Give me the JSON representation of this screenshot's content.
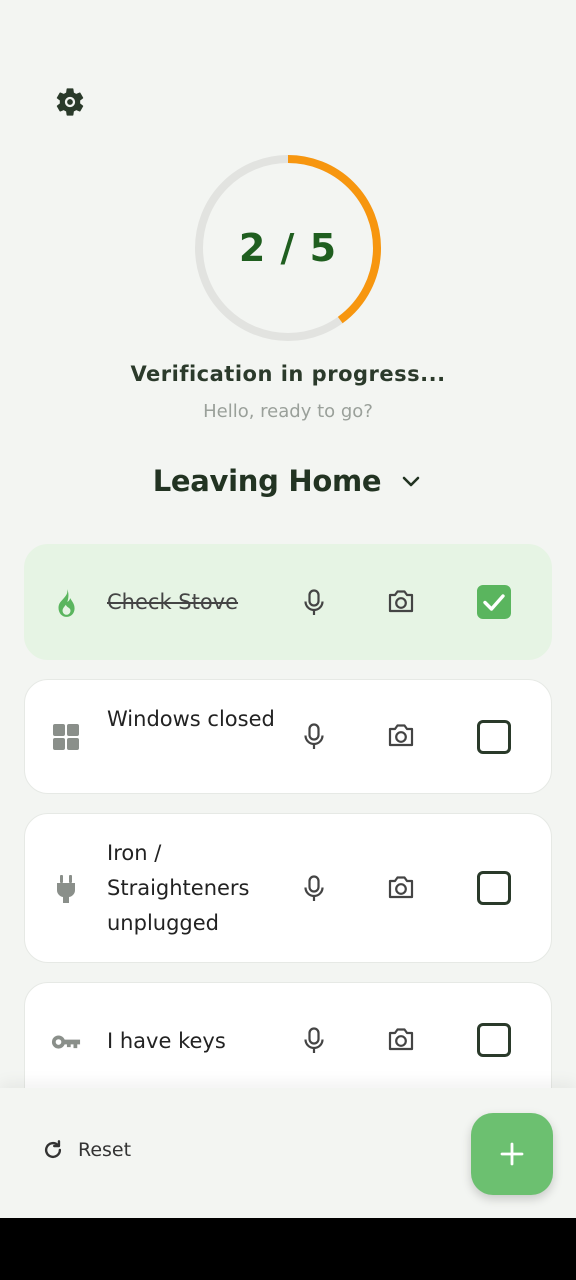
{
  "header": {
    "settings_icon": "gear-icon"
  },
  "progress": {
    "completed": 2,
    "total": 5,
    "text": "2 / 5",
    "fraction": 0.4,
    "ring_color": "#f7960f",
    "track_color": "#e2e3e0"
  },
  "status": {
    "text": "Verification in progress...",
    "greeting": "Hello, ready to go?"
  },
  "list": {
    "title": "Leaving Home",
    "dropdown_icon": "chevron-down-icon"
  },
  "items": [
    {
      "label": "Check Stove",
      "icon": "flame-icon",
      "checked": true
    },
    {
      "label": "Windows closed",
      "icon": "window-icon",
      "checked": false
    },
    {
      "label": "Iron / Straighteners unplugged",
      "icon": "plug-icon",
      "checked": false
    },
    {
      "label": "I have keys",
      "icon": "key-icon",
      "checked": false
    }
  ],
  "footer": {
    "reset_label": "Reset",
    "add_icon": "plus-icon"
  },
  "colors": {
    "accent_green": "#6cc070",
    "checked_green": "#5ab55e",
    "done_card_bg": "#e6f4e4",
    "progress_orange": "#f7960f",
    "title_green": "#1f5e1f"
  }
}
